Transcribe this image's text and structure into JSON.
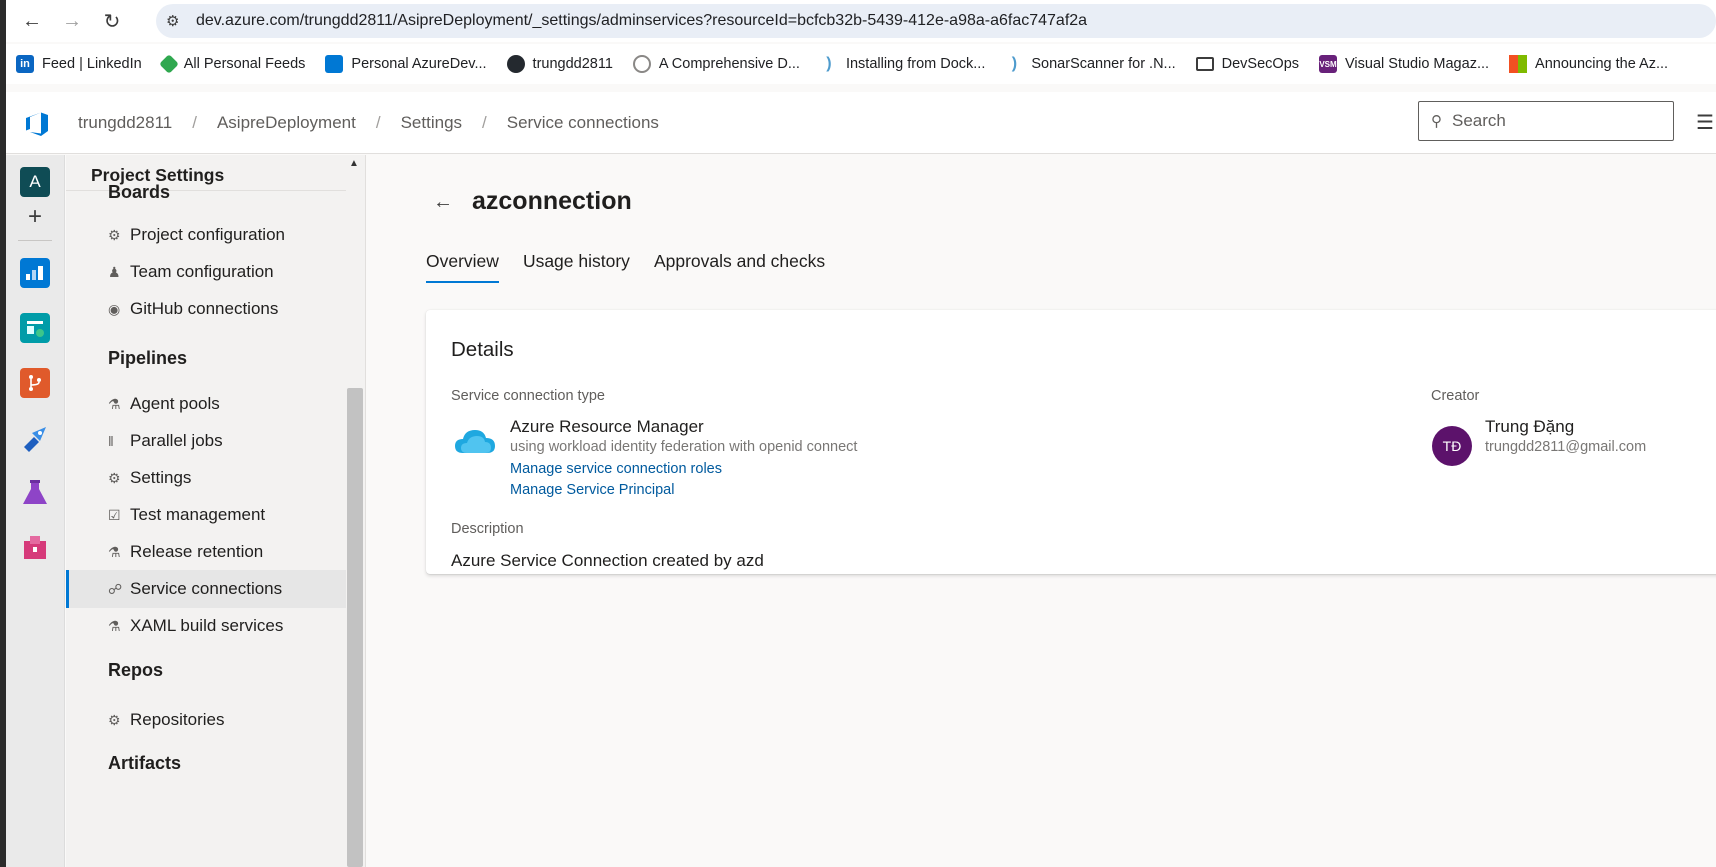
{
  "browser": {
    "url": "dev.azure.com/trungdd2811/AsipreDeployment/_settings/adminservices?resourceId=bcfcb32b-5439-412e-a98a-a6fac747af2a",
    "back_icon": "arrow-left-icon",
    "forward_icon": "arrow-right-icon",
    "reload_icon": "reload-icon"
  },
  "bookmarks": [
    {
      "label": "Feed | LinkedIn",
      "icon": "linkedin-icon",
      "color": "#0a66c2"
    },
    {
      "label": "All Personal Feeds",
      "icon": "feeds-icon",
      "color": "#2fa84f"
    },
    {
      "label": "Personal AzureDev...",
      "icon": "azure-devops-icon",
      "color": "#0078d4"
    },
    {
      "label": "trungdd2811",
      "icon": "github-icon",
      "color": "#24292f"
    },
    {
      "label": "A Comprehensive D...",
      "icon": "gear-site-icon",
      "color": "#8a8886"
    },
    {
      "label": "Installing from Dock...",
      "icon": "sonar-icon",
      "color": "#4e9bcd"
    },
    {
      "label": "SonarScanner for .N...",
      "icon": "sonar-icon",
      "color": "#4e9bcd"
    },
    {
      "label": "DevSecOps",
      "icon": "folder-icon",
      "color": "#3c3c3c"
    },
    {
      "label": "Visual Studio Magaz...",
      "icon": "vsm-icon",
      "color": "#68217a"
    },
    {
      "label": "Announcing the Az...",
      "icon": "microsoft-icon",
      "color": "#f25022"
    }
  ],
  "header": {
    "breadcrumb": [
      "trungdd2811",
      "AsipreDeployment",
      "Settings",
      "Service connections"
    ],
    "search_placeholder": "Search"
  },
  "rail": {
    "org_initial": "A"
  },
  "settings_nav": {
    "title": "Project Settings",
    "sections": {
      "boards": "Boards",
      "pipelines": "Pipelines",
      "repos": "Repos",
      "artifacts": "Artifacts"
    },
    "items": {
      "project_configuration": "Project configuration",
      "team_configuration": "Team configuration",
      "github_connections": "GitHub connections",
      "agent_pools": "Agent pools",
      "parallel_jobs": "Parallel jobs",
      "settings": "Settings",
      "test_management": "Test management",
      "release_retention": "Release retention",
      "service_connections": "Service connections",
      "xaml_build_services": "XAML build services",
      "repositories": "Repositories"
    },
    "active_item": "Service connections"
  },
  "main": {
    "title": "azconnection",
    "tabs": [
      "Overview",
      "Usage history",
      "Approvals and checks"
    ],
    "active_tab": "Overview",
    "details": {
      "heading": "Details",
      "type_label": "Service connection type",
      "type_name": "Azure Resource Manager",
      "type_sub": "using workload identity federation with openid connect",
      "link_roles": "Manage service connection roles",
      "link_principal": "Manage Service Principal",
      "description_label": "Description",
      "description": "Azure Service Connection created by azd",
      "creator_label": "Creator",
      "creator_initials": "TĐ",
      "creator_name": "Trung Đặng",
      "creator_email": "trungdd2811@gmail.com"
    }
  }
}
